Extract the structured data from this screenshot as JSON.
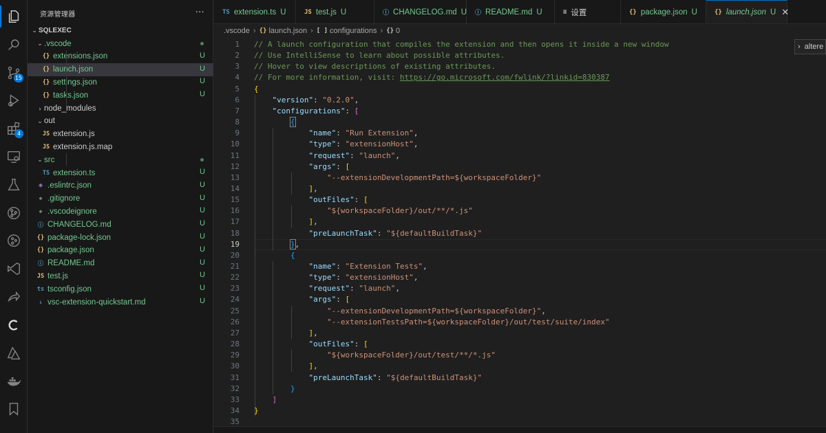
{
  "explorer": {
    "title": "资源管理器",
    "more": "···",
    "root": "SQLEXEC",
    "tree": [
      {
        "label": ".vscode",
        "kind": "folder",
        "open": true,
        "depth": 1,
        "color": "green",
        "status": "dot"
      },
      {
        "label": "extensions.json",
        "kind": "json",
        "depth": 2,
        "color": "green",
        "status": "U"
      },
      {
        "label": "launch.json",
        "kind": "json",
        "depth": 2,
        "color": "green",
        "status": "U",
        "selected": true
      },
      {
        "label": "settings.json",
        "kind": "json",
        "depth": 2,
        "color": "green",
        "status": "U"
      },
      {
        "label": "tasks.json",
        "kind": "json",
        "depth": 2,
        "color": "green",
        "status": "U"
      },
      {
        "label": "node_modules",
        "kind": "folder",
        "open": false,
        "depth": 1,
        "color": "gray",
        "status": ""
      },
      {
        "label": "out",
        "kind": "folder",
        "open": true,
        "depth": 1,
        "color": "gray",
        "status": ""
      },
      {
        "label": "extension.js",
        "kind": "js",
        "depth": 2,
        "color": "gray",
        "status": ""
      },
      {
        "label": "extension.js.map",
        "kind": "js",
        "depth": 2,
        "color": "gray",
        "status": ""
      },
      {
        "label": "src",
        "kind": "folder",
        "open": true,
        "depth": 1,
        "color": "green",
        "status": "dot"
      },
      {
        "label": "extension.ts",
        "kind": "ts",
        "depth": 2,
        "color": "green",
        "status": "U"
      },
      {
        "label": ".eslintrc.json",
        "kind": "eslint",
        "depth": 1,
        "color": "green",
        "status": "U"
      },
      {
        "label": ".gitignore",
        "kind": "diamond",
        "depth": 1,
        "color": "green",
        "status": "U"
      },
      {
        "label": ".vscodeignore",
        "kind": "diamond",
        "depth": 1,
        "color": "green",
        "status": "U"
      },
      {
        "label": "CHANGELOG.md",
        "kind": "info",
        "depth": 1,
        "color": "green",
        "status": "U"
      },
      {
        "label": "package-lock.json",
        "kind": "json",
        "depth": 1,
        "color": "green",
        "status": "U"
      },
      {
        "label": "package.json",
        "kind": "json",
        "depth": 1,
        "color": "green",
        "status": "U"
      },
      {
        "label": "README.md",
        "kind": "info",
        "depth": 1,
        "color": "green",
        "status": "U"
      },
      {
        "label": "test.js",
        "kind": "js",
        "depth": 1,
        "color": "green",
        "status": "U"
      },
      {
        "label": "tsconfig.json",
        "kind": "tsconfig",
        "depth": 1,
        "color": "green",
        "status": "U"
      },
      {
        "label": "vsc-extension-quickstart.md",
        "kind": "md",
        "depth": 1,
        "color": "green",
        "status": "U"
      }
    ]
  },
  "activity": {
    "items": [
      {
        "name": "explorer",
        "badge": ""
      },
      {
        "name": "search",
        "badge": ""
      },
      {
        "name": "source-control",
        "badge": "15"
      },
      {
        "name": "run-debug",
        "badge": ""
      },
      {
        "name": "extensions",
        "badge": "4"
      },
      {
        "name": "remote-explorer",
        "badge": ""
      },
      {
        "name": "testing",
        "badge": ""
      },
      {
        "name": "git-graph",
        "badge": ""
      },
      {
        "name": "git-lens",
        "badge": ""
      },
      {
        "name": "visual-studio",
        "badge": ""
      },
      {
        "name": "live-share",
        "badge": ""
      },
      {
        "name": "codeium",
        "badge": ""
      },
      {
        "name": "azure",
        "badge": ""
      },
      {
        "name": "docker",
        "badge": ""
      },
      {
        "name": "bookmarks",
        "badge": ""
      }
    ]
  },
  "tabs": [
    {
      "label": "extension.ts",
      "icon": "TS",
      "status": "U"
    },
    {
      "label": "test.js",
      "icon": "JS",
      "status": "U"
    },
    {
      "label": "CHANGELOG.md",
      "icon": "ⓘ",
      "status": "U"
    },
    {
      "label": "README.md",
      "icon": "ⓘ",
      "status": "U"
    },
    {
      "label": "设置",
      "icon": "≡",
      "status": ""
    },
    {
      "label": "package.json",
      "icon": "{}",
      "status": "U"
    },
    {
      "label": "launch.json",
      "icon": "{}",
      "status": "U",
      "active": true,
      "close": "✕"
    }
  ],
  "breadcrumb": {
    "folder": ".vscode",
    "file": "launch.json",
    "array": "configurations",
    "index": "0",
    "sep": "›"
  },
  "side_widget": {
    "label": "altere",
    "chevron": "›"
  },
  "editor": {
    "current_line": 19,
    "lines": [
      "// A launch configuration that compiles the extension and then opens it inside a new window",
      "// Use IntelliSense to learn about possible attributes.",
      "// Hover to view descriptions of existing attributes.",
      "// For more information, visit: https://go.microsoft.com/fwlink/?linkid=830387",
      "{",
      "    \"version\": \"0.2.0\",",
      "    \"configurations\": [",
      "        {",
      "            \"name\": \"Run Extension\",",
      "            \"type\": \"extensionHost\",",
      "            \"request\": \"launch\",",
      "            \"args\": [",
      "                \"--extensionDevelopmentPath=${workspaceFolder}\"",
      "            ],",
      "            \"outFiles\": [",
      "                \"${workspaceFolder}/out/**/*.js\"",
      "            ],",
      "            \"preLaunchTask\": \"${defaultBuildTask}\"",
      "        },",
      "        {",
      "            \"name\": \"Extension Tests\",",
      "            \"type\": \"extensionHost\",",
      "            \"request\": \"launch\",",
      "            \"args\": [",
      "                \"--extensionDevelopmentPath=${workspaceFolder}\",",
      "                \"--extensionTestsPath=${workspaceFolder}/out/test/suite/index\"",
      "            ],",
      "            \"outFiles\": [",
      "                \"${workspaceFolder}/out/test/**/*.js\"",
      "            ],",
      "            \"preLaunchTask\": \"${defaultBuildTask}\"",
      "        }",
      "    ]",
      "}",
      ""
    ]
  },
  "colors": {
    "accent": "#0078d4",
    "untracked": "#73c991",
    "comment": "#6a9955",
    "key": "#9cdcfe",
    "string": "#ce9178"
  }
}
